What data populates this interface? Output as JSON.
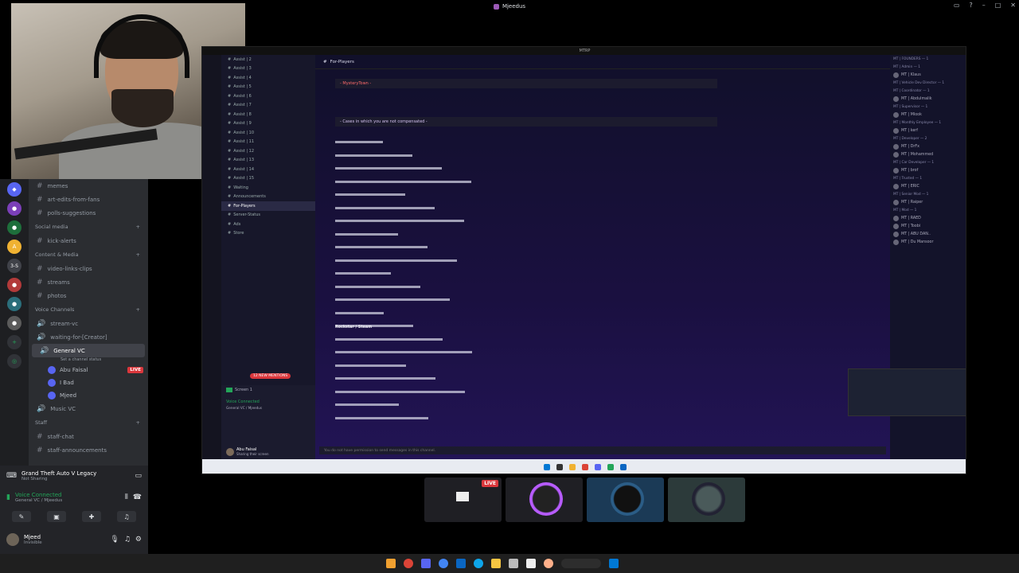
{
  "window": {
    "title": "Mjeedus"
  },
  "channels": {
    "items": [
      {
        "type": "channel",
        "name": "memes"
      },
      {
        "type": "channel",
        "name": "art-edits-from-fans"
      },
      {
        "type": "channel",
        "name": "polls-suggestions"
      },
      {
        "type": "category",
        "name": "Social media"
      },
      {
        "type": "channel",
        "name": "kick-alerts"
      },
      {
        "type": "category",
        "name": "Content & Media"
      },
      {
        "type": "channel",
        "name": "video-links-clips"
      },
      {
        "type": "channel",
        "name": "streams"
      },
      {
        "type": "channel",
        "name": "photos"
      },
      {
        "type": "category",
        "name": "Voice Channels"
      },
      {
        "type": "voice",
        "name": "stream-vc"
      },
      {
        "type": "voice",
        "name": "waiting-for-[Creator]"
      },
      {
        "type": "voice-active",
        "name": "General VC",
        "status": "Set a channel status"
      },
      {
        "type": "voice",
        "name": "Music VC"
      },
      {
        "type": "category",
        "name": "Staff"
      },
      {
        "type": "channel",
        "name": "staff-chat"
      },
      {
        "type": "channel",
        "name": "staff-announcements"
      }
    ],
    "vc_users": [
      {
        "name": "Abu Faisal",
        "live": "LIVE"
      },
      {
        "name": "I Bad"
      },
      {
        "name": "Mjeed"
      }
    ]
  },
  "bottom": {
    "game": "Grand Theft Auto V Legacy",
    "game_status": "Not Sharing",
    "voice_connected": "Voice Connected",
    "voice_location": "General VC / Mjeedus",
    "username": "Mjeed",
    "user_status": "Invisible"
  },
  "stream": {
    "window_title": "MTRP",
    "channel_header": "For-Players",
    "codebox1": "- MysteryTown -",
    "codebox2": "- Cases in which you are not compensated -",
    "mentions_badge": "12 NEW MENTIONS",
    "rockstar_line": "Rockstar / Steam",
    "input_placeholder": "You do not have permission to send messages in this channel.",
    "voice_connected": "Voice Connected",
    "voice_location": "General VC / Mjeedus",
    "screen_label": "Screen 1",
    "user_name": "Abu Faisal",
    "user_status": "Sharing their screen",
    "channels": [
      "Assist | 2",
      "Assist | 3",
      "Assist | 4",
      "Assist | 5",
      "Assist | 6",
      "Assist | 7",
      "Assist | 8",
      "Assist | 9",
      "Assist | 10",
      "Assist | 11",
      "Assist | 12",
      "Assist | 13",
      "Assist | 14",
      "Assist | 15",
      "Waiting",
      "Announcements",
      "For-Players",
      "Server-Status",
      "Ads",
      "Store"
    ],
    "members": [
      {
        "role": "MT | FOUNDERS — 1"
      },
      {
        "role": "MT | Admin — 1"
      },
      {
        "name": "MT | Klaus"
      },
      {
        "role": "MT | Vehicle Dev Director — 1"
      },
      {
        "role": "MT | Coordinator — 1"
      },
      {
        "name": "MT | Abdulmalik"
      },
      {
        "role": "MT | Supervisor — 1"
      },
      {
        "name": "MT | Mlook"
      },
      {
        "role": "MT | Monthly Employee — 1"
      },
      {
        "name": "MT | kerf"
      },
      {
        "role": "MT | Developer — 2"
      },
      {
        "name": "MT | DrFx"
      },
      {
        "name": "MT | Mohammed"
      },
      {
        "role": "MT | Car Developer — 1"
      },
      {
        "name": "MT | brof"
      },
      {
        "role": "MT | Trusted — 1"
      },
      {
        "name": "MT | ERIC"
      },
      {
        "role": "MT | Senior Mod — 1"
      },
      {
        "name": "MT | Raiper"
      },
      {
        "role": "MT | Mod — 1"
      },
      {
        "name": "MT | RAED"
      },
      {
        "name": "MT | Toobi"
      },
      {
        "name": "MT | ABU DAN.."
      },
      {
        "name": "MT | Du Mansoor"
      }
    ]
  },
  "thumbs": {
    "live": "LIVE"
  }
}
